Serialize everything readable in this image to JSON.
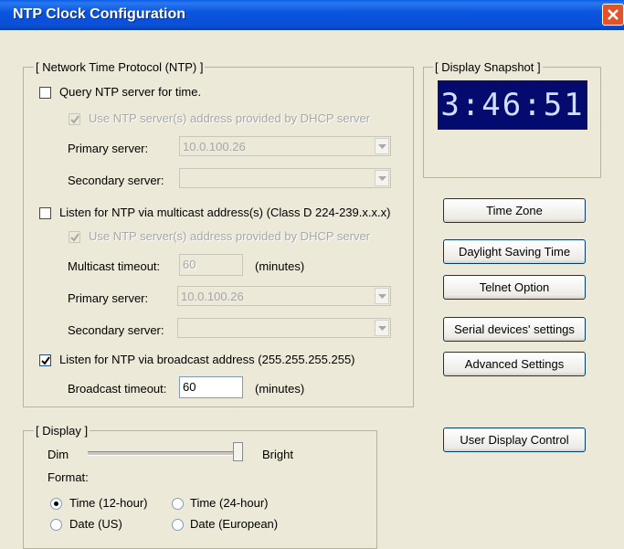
{
  "window": {
    "title": "NTP Clock Configuration"
  },
  "ntp_group": {
    "legend": "[ Network Time Protocol (NTP) ]",
    "query": {
      "label": "Query NTP server for time.",
      "checked": false,
      "use_dhcp_label": "Use NTP server(s) address  provided by DHCP server",
      "primary_label": "Primary server:",
      "primary_value": "10.0.100.26",
      "secondary_label": "Secondary server:",
      "secondary_value": ""
    },
    "multicast": {
      "label": "Listen for NTP via multicast address(s) (Class D 224-239.x.x.x)",
      "checked": false,
      "use_dhcp_label": "Use NTP server(s) address  provided by DHCP server",
      "timeout_label": "Multicast timeout:",
      "timeout_value": "60",
      "timeout_unit": "(minutes)",
      "primary_label": "Primary server:",
      "primary_value": "10.0.100.26",
      "secondary_label": "Secondary server:",
      "secondary_value": ""
    },
    "broadcast": {
      "label": "Listen for NTP via broadcast address (255.255.255.255)",
      "checked": true,
      "timeout_label": "Broadcast timeout:",
      "timeout_value": "60",
      "timeout_unit": "(minutes)"
    }
  },
  "snapshot": {
    "legend": "[ Display Snapshot ]",
    "time": "3:46:51"
  },
  "buttons": {
    "time_zone": "Time Zone",
    "daylight": "Daylight Saving Time",
    "telnet": "Telnet Option",
    "serial": "Serial devices' settings",
    "advanced": "Advanced Settings",
    "user_display": "User Display Control"
  },
  "display_group": {
    "legend": "[ Display ]",
    "dim_label": "Dim",
    "bright_label": "Bright",
    "brightness_level": 1.0,
    "format_label": "Format:",
    "options": {
      "time12": "Time (12-hour)",
      "time24": "Time (24-hour)",
      "date_us": "Date (US)",
      "date_eu": "Date (European)"
    },
    "selected": "time12"
  }
}
